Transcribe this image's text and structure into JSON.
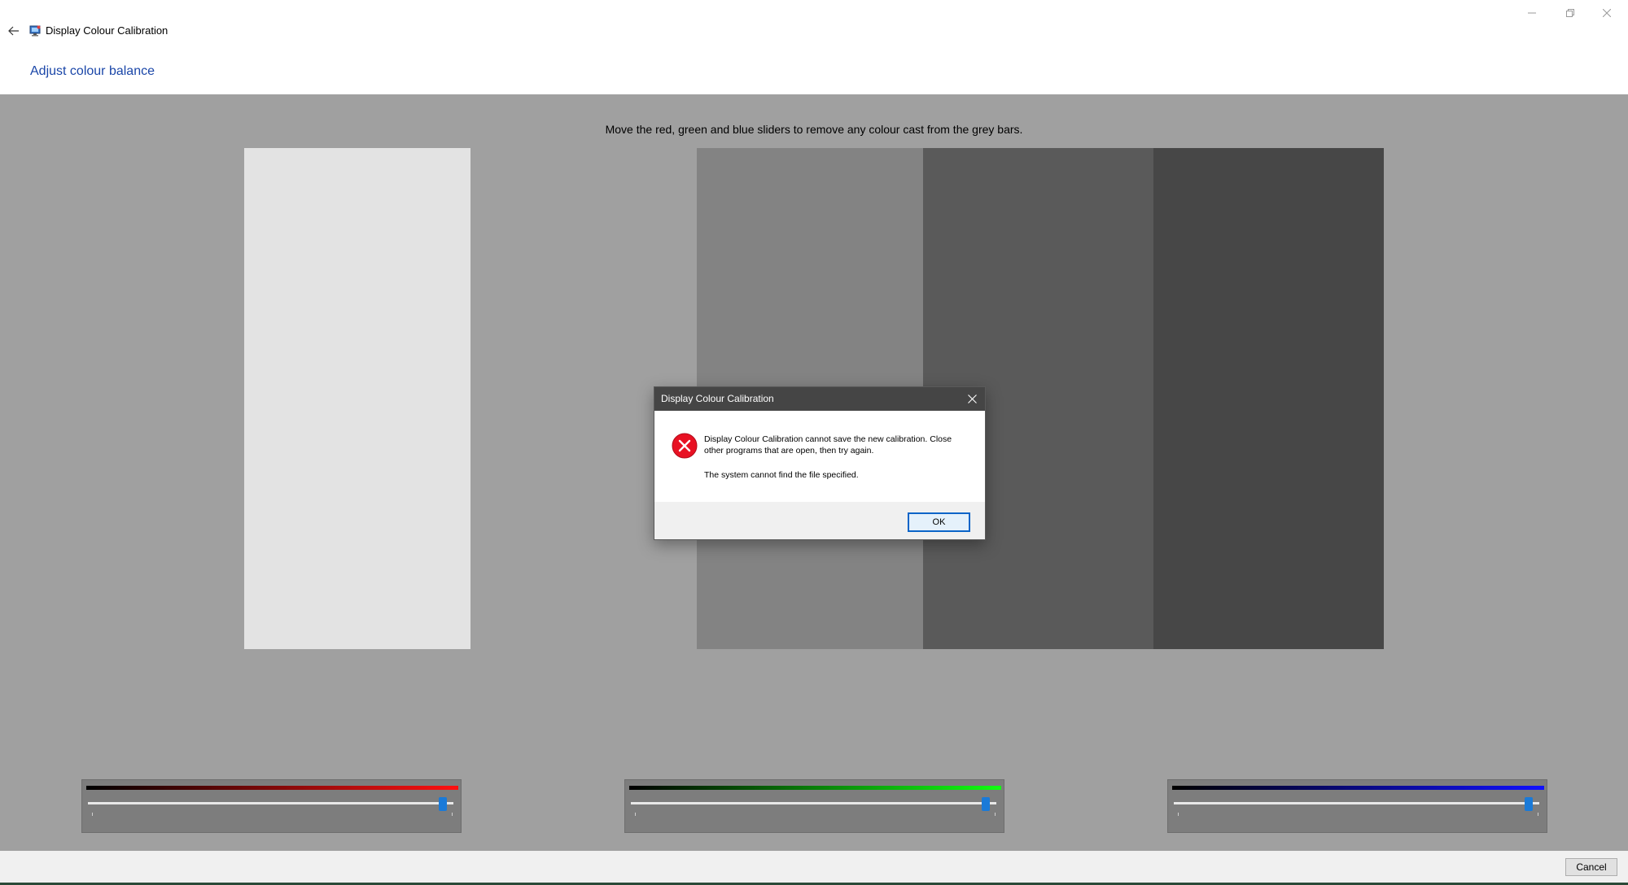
{
  "window": {
    "title": "Display Colour Calibration",
    "back_icon": "arrow-left-icon",
    "controls": [
      "minimize-icon",
      "restore-icon",
      "close-icon"
    ]
  },
  "page": {
    "heading": "Adjust colour balance",
    "instructions": "Move the red, green and blue sliders to remove any colour cast from the grey bars."
  },
  "grey_bars": [
    "#e3e3e3",
    "#a0a0a0",
    "#838383",
    "#5a5a5a",
    "#474747"
  ],
  "sliders": [
    {
      "channel": "red",
      "color": "#ff1010",
      "value_fraction": 0.97
    },
    {
      "channel": "green",
      "color": "#10ff10",
      "value_fraction": 0.97
    },
    {
      "channel": "blue",
      "color": "#1010ff",
      "value_fraction": 0.97
    }
  ],
  "footer": {
    "cancel_label": "Cancel"
  },
  "dialog": {
    "title": "Display Colour Calibration",
    "icon": "error-icon",
    "message": "Display Colour Calibration cannot save the new calibration. Close other programs that are open, then try again.",
    "detail": "The system cannot find the file specified.",
    "ok_label": "OK"
  },
  "colors": {
    "heading": "#1a46a8",
    "accent": "#1a7ad8",
    "error": "#e81123",
    "dialog_title_bg": "#454545"
  }
}
